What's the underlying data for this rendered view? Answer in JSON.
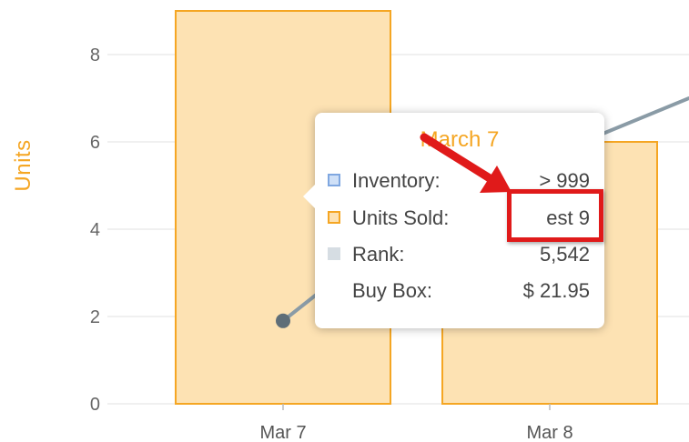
{
  "chart_data": {
    "type": "bar",
    "categories": [
      "Mar 7",
      "Mar 8"
    ],
    "series": [
      {
        "values": [
          9,
          6
        ],
        "color": "#fde2b3",
        "stroke": "#f5a623"
      }
    ],
    "line_series": {
      "x": [
        "Mar 7"
      ],
      "values": [
        1.9
      ],
      "color": "#8a9ba6",
      "marker_color": "#5f6e78"
    },
    "ylabel": "Units",
    "xlabel": "",
    "ylim": [
      0,
      9
    ],
    "yticks": [
      0,
      2,
      4,
      6,
      8
    ],
    "grid": true
  },
  "tooltip": {
    "title": "March 7",
    "rows": [
      {
        "label": "Inventory:",
        "value": "> 999",
        "swatch_fill": "#cfe0f7",
        "swatch_stroke": "#7fa7e0"
      },
      {
        "label": "Units Sold:",
        "value": "est 9",
        "swatch_fill": "#fde2b3",
        "swatch_stroke": "#f5a623"
      },
      {
        "label": "Rank:",
        "value": "5,542",
        "swatch_fill": "#d6dde3",
        "swatch_stroke": "#d6dde3"
      },
      {
        "label": "Buy Box:",
        "value": "$ 21.95",
        "swatch_fill": "",
        "swatch_stroke": ""
      }
    ]
  },
  "annotation": {
    "highlight_color": "#e01a1a",
    "arrow_color": "#e01a1a"
  }
}
